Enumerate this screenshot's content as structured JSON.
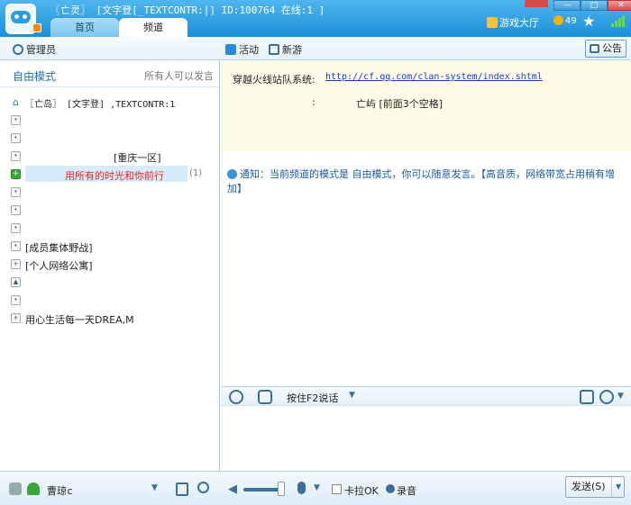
{
  "titlebar": {
    "title": "〖亡灵〗 [文字登[_TEXTCONTR:|] ID:100764 在线:1 ]",
    "tabs": [
      {
        "label": "首页"
      },
      {
        "label": "频道"
      }
    ],
    "game_hall": "游戏大厅",
    "coins": "49"
  },
  "toolbar": {
    "admin": "管理员",
    "activity": "活动",
    "new_game": "新游",
    "notice": "公告"
  },
  "left": {
    "mode": "自由模式",
    "mode_hint": "所有人可以发言",
    "tree": [
      {
        "label": "〖亡岛〗  [文字登] ,TEXTCONTR:1"
      },
      {
        "label": ""
      },
      {
        "label": ""
      },
      {
        "label": "[重庆一区]"
      },
      {
        "label": "用所有的时光和你前行",
        "count": "(1)"
      },
      {
        "label": ""
      },
      {
        "label": ""
      },
      {
        "label": ""
      },
      {
        "label": "[成员集体野战]"
      },
      {
        "label": "[个人网络公寓]"
      },
      {
        "label": ""
      },
      {
        "label": ""
      },
      {
        "label": "用心生活每一天DREA,M"
      }
    ]
  },
  "right": {
    "system_label": "穿越火线站队系统:",
    "system_link": "http://cf.qq.com/clan-system/index.shtml",
    "info_colon": ":",
    "info_text": "亡屿 [前面3个空格]",
    "notice": "通知：当前频道的模式是 自由模式，你可以随意发言。【高音质，网络带宽占用稍有增加】"
  },
  "input_toolbar": {
    "ptt": "按住F2说话"
  },
  "bottom": {
    "user_name": "曹琼c",
    "karaoke": "卡拉OK",
    "record": "录音",
    "send": "发送(S)"
  }
}
